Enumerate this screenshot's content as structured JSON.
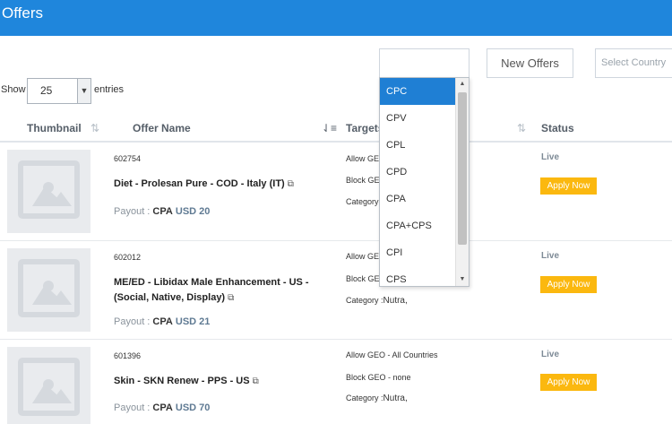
{
  "header": {
    "title": "Offers"
  },
  "filters": {
    "new_offers_label": "New Offers",
    "country_placeholder": "Select Country"
  },
  "length": {
    "show_label": "Show",
    "value": "25",
    "entries_label": "entries"
  },
  "table": {
    "columns": [
      "Thumbnail",
      "Offer Name",
      "Targets",
      "Status"
    ],
    "rows": [
      {
        "id": "602754",
        "name": "Diet - Prolesan Pure - COD - Italy (IT)",
        "payout_label": "Payout :",
        "payout_type": "CPA",
        "payout_amount": "USD 20",
        "allow_geo": "Allow GE",
        "block_geo": "Block GE",
        "category": "Category :",
        "status": "Live",
        "action": "Apply Now"
      },
      {
        "id": "602012",
        "name": "ME/ED - Libidax Male Enhancement - US - (Social, Native, Display)",
        "payout_label": "Payout :",
        "payout_type": "CPA",
        "payout_amount": "USD 21",
        "allow_geo": "Allow GE",
        "block_geo": "Block GE",
        "category": "Category :",
        "category_value": "Nutra,",
        "status": "Live",
        "action": "Apply Now"
      },
      {
        "id": "601396",
        "name": "Skin - SKN Renew - PPS - US",
        "payout_label": "Payout :",
        "payout_type": "CPA",
        "payout_amount": "USD 70",
        "allow_geo": "Allow GEO - All Countries",
        "block_geo": "Block GEO - none",
        "category": "Category :",
        "category_value": "Nutra,",
        "status": "Live",
        "action": "Apply Now"
      }
    ]
  },
  "dropdown": {
    "options": [
      "CPC",
      "CPV",
      "CPL",
      "CPD",
      "CPA",
      "CPA+CPS",
      "CPI",
      "CPS"
    ],
    "selected": "CPC"
  },
  "icons": {
    "sort": "sort-icon",
    "external_link": "external-link-icon",
    "image_placeholder": "image-placeholder-icon"
  },
  "colors": {
    "header": "#1f86dc",
    "apply": "#fbb80f",
    "selected": "#1f7fd4"
  }
}
